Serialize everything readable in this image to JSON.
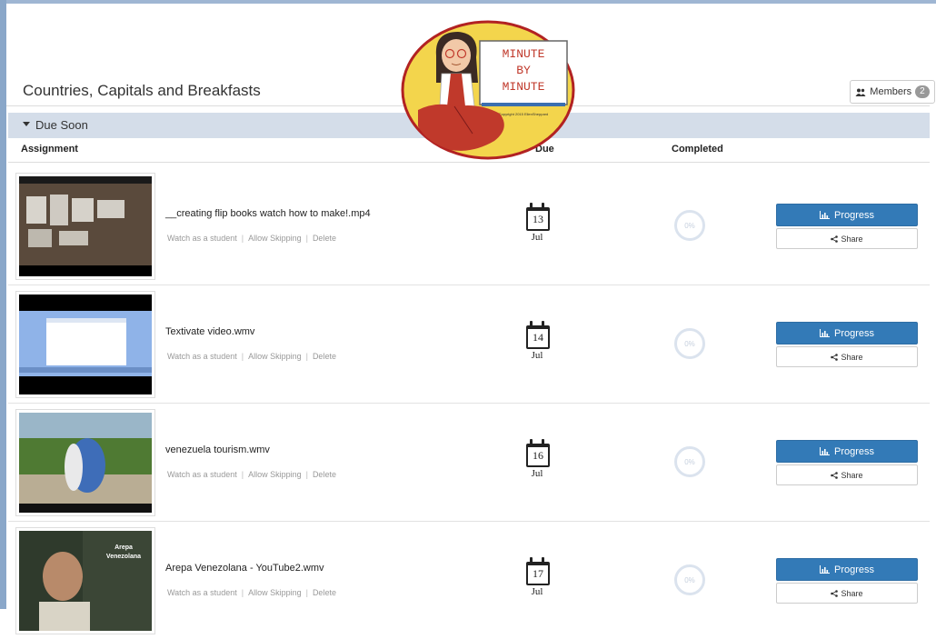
{
  "header": {
    "title": "Countries, Capitals and Breakfasts",
    "members_label": "Members",
    "members_count": "2"
  },
  "section": {
    "label": "Due Soon"
  },
  "columns": {
    "assignment": "Assignment",
    "due": "Due",
    "completed": "Completed"
  },
  "logo": {
    "line1": "MINUTE",
    "line2": "BY",
    "line3": "MINUTE",
    "copyright": "Copyright 2015 EllenSheppard"
  },
  "assignments": [
    {
      "title": "__creating flip books watch how to make!.mp4",
      "day": "13",
      "month": "Jul",
      "completed": "0%"
    },
    {
      "title": "Textivate video.wmv",
      "day": "14",
      "month": "Jul",
      "completed": "0%"
    },
    {
      "title": "venezuela tourism.wmv",
      "day": "16",
      "month": "Jul",
      "completed": "0%"
    },
    {
      "title": "Arepa Venezolana - YouTube2.wmv",
      "day": "17",
      "month": "Jul",
      "completed": "0%",
      "thumb_text": "Arepa Venezolana"
    }
  ],
  "links": {
    "watch": "Watch as a student",
    "skip": "Allow Skipping",
    "delete": "Delete"
  },
  "buttons": {
    "progress": "Progress",
    "share": "Share"
  },
  "colors": {
    "primary": "#337ab7",
    "section_bar": "#d4dde9",
    "logo_bg": "#f3d54c",
    "logo_border": "#b22222"
  }
}
